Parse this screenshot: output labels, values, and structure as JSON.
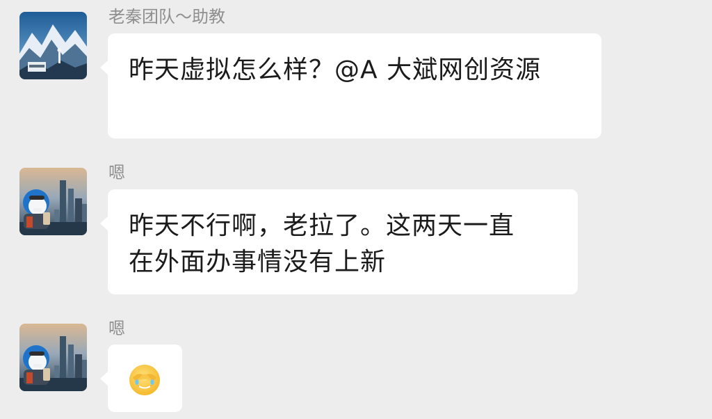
{
  "messages": [
    {
      "sender": "老秦团队～助教",
      "lines": [
        "昨天虚拟怎么样？@A 大斌网创资源"
      ],
      "avatar": "mountain-avatar"
    },
    {
      "sender": "嗯",
      "lines": [
        "昨天不行啊，老拉了。这两天一直",
        "在外面办事情没有上新"
      ],
      "avatar": "doraemon-city-avatar"
    },
    {
      "sender": "嗯",
      "emoji": "face-palm-laughing-emoji",
      "avatar": "doraemon-city-avatar"
    }
  ],
  "colors": {
    "background": "#ededed",
    "bubble": "#ffffff",
    "sender_text": "#8f8f8f",
    "message_text": "#1b1b1b"
  }
}
